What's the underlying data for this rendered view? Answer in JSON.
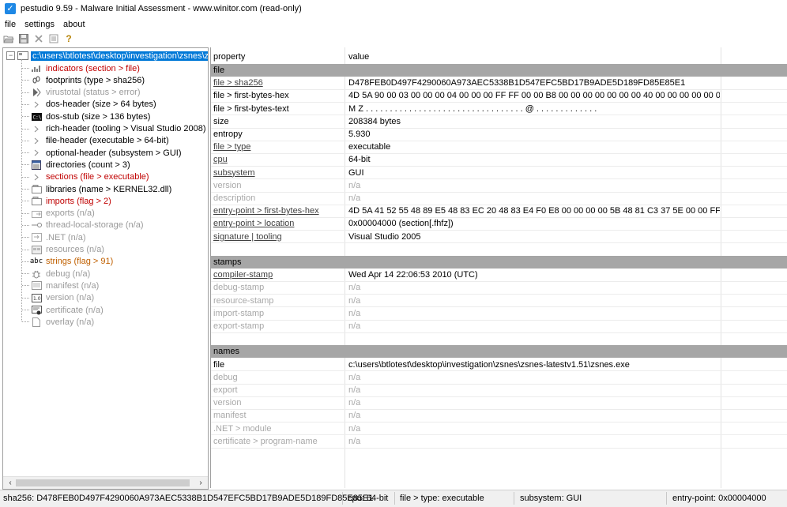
{
  "window": {
    "title": "pestudio 9.59 - Malware Initial Assessment - www.winitor.com (read-only)"
  },
  "menu": [
    "file",
    "settings",
    "about"
  ],
  "toolbar": [
    "open-icon",
    "save-icon",
    "close-icon",
    "list-icon",
    "help-icon"
  ],
  "tree": {
    "root": "c:\\users\\btlotest\\desktop\\investigation\\zsnes\\zsn",
    "items": [
      {
        "label": "indicators (section > file)",
        "color": "red",
        "icon": "indicators-icon"
      },
      {
        "label": "footprints (type > sha256)",
        "color": "black",
        "icon": "footprints-icon"
      },
      {
        "label": "virustotal (status > error)",
        "color": "gray",
        "icon": "virustotal-icon"
      },
      {
        "label": "dos-header (size > 64 bytes)",
        "color": "black",
        "icon": "arrow-icon"
      },
      {
        "label": "dos-stub (size > 136 bytes)",
        "color": "black",
        "icon": "console-icon"
      },
      {
        "label": "rich-header (tooling > Visual Studio 2008)",
        "color": "black",
        "icon": "arrow-icon"
      },
      {
        "label": "file-header (executable > 64-bit)",
        "color": "black",
        "icon": "arrow-icon"
      },
      {
        "label": "optional-header (subsystem > GUI)",
        "color": "black",
        "icon": "arrow-icon"
      },
      {
        "label": "directories (count > 3)",
        "color": "black",
        "icon": "directories-icon"
      },
      {
        "label": "sections (file > executable)",
        "color": "red",
        "icon": "arrow-icon"
      },
      {
        "label": "libraries (name > KERNEL32.dll)",
        "color": "black",
        "icon": "libraries-icon"
      },
      {
        "label": "imports (flag > 2)",
        "color": "red",
        "icon": "imports-icon"
      },
      {
        "label": "exports (n/a)",
        "color": "gray",
        "icon": "exports-icon"
      },
      {
        "label": "thread-local-storage (n/a)",
        "color": "gray",
        "icon": "tls-icon"
      },
      {
        "label": ".NET (n/a)",
        "color": "gray",
        "icon": "dotnet-icon"
      },
      {
        "label": "resources (n/a)",
        "color": "gray",
        "icon": "resources-icon"
      },
      {
        "label": "strings (flag > 91)",
        "color": "orange",
        "icon": "strings-icon"
      },
      {
        "label": "debug (n/a)",
        "color": "gray",
        "icon": "debug-icon"
      },
      {
        "label": "manifest (n/a)",
        "color": "gray",
        "icon": "manifest-icon"
      },
      {
        "label": "version (n/a)",
        "color": "gray",
        "icon": "version-icon"
      },
      {
        "label": "certificate (n/a)",
        "color": "gray",
        "icon": "certificate-icon"
      },
      {
        "label": "overlay (n/a)",
        "color": "gray",
        "icon": "overlay-icon"
      }
    ]
  },
  "table": {
    "header": {
      "property": "property",
      "value": "value"
    },
    "rows": [
      {
        "type": "section",
        "property": "file",
        "value": ""
      },
      {
        "type": "link",
        "property": "file > sha256",
        "value": "D478FEB0D497F4290060A973AEC5338B1D547EFC5BD17B9ADE5D189FD85E85E1"
      },
      {
        "type": "plain",
        "property": "file > first-bytes-hex",
        "value": "4D 5A 90 00 03 00 00 00 04 00 00 00 FF FF 00 00 B8 00 00 00 00 00 00 00 40 00 00 00 00 00 00 00"
      },
      {
        "type": "plain",
        "property": "file > first-bytes-text",
        "value": "M Z . . . . . . . . . . . . . . . . . . . . . . . . . . . . . . . . . @ . . . . . . . . . . . . ."
      },
      {
        "type": "plain",
        "property": "size",
        "value": "208384 bytes"
      },
      {
        "type": "plain",
        "property": "entropy",
        "value": "5.930"
      },
      {
        "type": "link",
        "property": "file > type",
        "value": "executable"
      },
      {
        "type": "link",
        "property": "cpu",
        "value": "64-bit"
      },
      {
        "type": "link",
        "property": "subsystem",
        "value": "GUI"
      },
      {
        "type": "dim",
        "property": "version",
        "value": "n/a"
      },
      {
        "type": "dim",
        "property": "description",
        "value": "n/a"
      },
      {
        "type": "link",
        "property": "entry-point > first-bytes-hex",
        "value": "4D 5A 41 52 55 48 89 E5 48 83 EC 20 48 83 E4 F0 E8 00 00 00 00 5B 48 81 C3 37 5E 00 00 FF D3 48 81"
      },
      {
        "type": "link",
        "property": "entry-point > location",
        "value": "0x00004000 (section[.fhfz])"
      },
      {
        "type": "link",
        "property": "signature | tooling",
        "value": "Visual Studio 2005"
      },
      {
        "type": "blank",
        "property": "",
        "value": ""
      },
      {
        "type": "section",
        "property": "stamps",
        "value": ""
      },
      {
        "type": "link",
        "property": "compiler-stamp",
        "value": "Wed Apr 14 22:06:53 2010 (UTC)"
      },
      {
        "type": "dim",
        "property": "debug-stamp",
        "value": "n/a"
      },
      {
        "type": "dim",
        "property": "resource-stamp",
        "value": "n/a"
      },
      {
        "type": "dim",
        "property": "import-stamp",
        "value": "n/a"
      },
      {
        "type": "dim",
        "property": "export-stamp",
        "value": "n/a"
      },
      {
        "type": "blank",
        "property": "",
        "value": ""
      },
      {
        "type": "section",
        "property": "names",
        "value": ""
      },
      {
        "type": "plain",
        "property": "file",
        "value": "c:\\users\\btlotest\\desktop\\investigation\\zsnes\\zsnes-latestv1.51\\zsnes.exe"
      },
      {
        "type": "dim",
        "property": "debug",
        "value": "n/a"
      },
      {
        "type": "dim",
        "property": "export",
        "value": "n/a"
      },
      {
        "type": "dim",
        "property": "version",
        "value": "n/a"
      },
      {
        "type": "dim",
        "property": "manifest",
        "value": "n/a"
      },
      {
        "type": "dim",
        "property": ".NET > module",
        "value": "n/a"
      },
      {
        "type": "dim",
        "property": "certificate > program-name",
        "value": "n/a"
      }
    ]
  },
  "statusbar": {
    "sha256": "sha256: D478FEB0D497F4290060A973AEC5338B1D547EFC5BD17B9ADE5D189FD85E85E1",
    "cpu": "cpu: 64-bit",
    "type": "file > type: executable",
    "subsystem": "subsystem: GUI",
    "entry": "entry-point: 0x00004000"
  },
  "colors": {
    "selection": "#0078d7",
    "section_header": "#a6a6a6",
    "red": "#c00000",
    "orange": "#c06000",
    "gray": "#9a9a9a"
  }
}
